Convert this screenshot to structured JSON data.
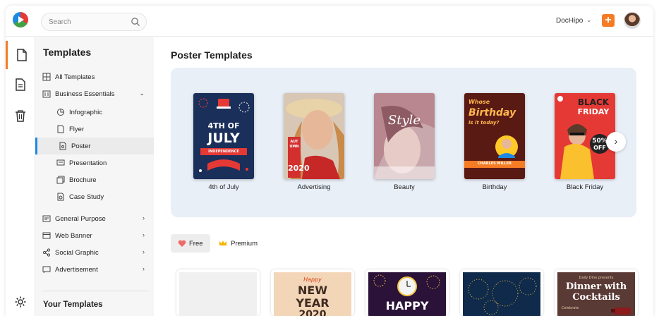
{
  "header": {
    "search_placeholder": "Search",
    "account_name": "DocHipo",
    "add_label": "+"
  },
  "sidebar": {
    "title": "Templates",
    "items": [
      {
        "label": "All Templates",
        "icon": "grid-icon"
      },
      {
        "label": "Business Essentials",
        "icon": "building-icon",
        "chevron": "⌄"
      },
      {
        "label": "Infographic",
        "icon": "chart-icon"
      },
      {
        "label": "Flyer",
        "icon": "flyer-icon"
      },
      {
        "label": "Poster",
        "icon": "poster-icon",
        "active": true
      },
      {
        "label": "Presentation",
        "icon": "presentation-icon"
      },
      {
        "label": "Brochure",
        "icon": "brochure-icon"
      },
      {
        "label": "Case Study",
        "icon": "case-study-icon"
      },
      {
        "label": "General Purpose",
        "icon": "doc-icon",
        "chevron": "›"
      },
      {
        "label": "Web Banner",
        "icon": "banner-icon",
        "chevron": "›"
      },
      {
        "label": "Social Graphic",
        "icon": "share-icon",
        "chevron": "›"
      },
      {
        "label": "Advertisement",
        "icon": "ad-icon",
        "chevron": "›"
      }
    ],
    "footer": "Your Templates"
  },
  "main": {
    "title": "Poster Templates",
    "carousel": [
      {
        "label": "4th of July",
        "text1": "4TH OF",
        "text2": "JULY",
        "banner": "INDEPENDENCE",
        "bg": "#1a2f5a"
      },
      {
        "label": "Advertising",
        "text1": "AUTUMN",
        "text2": "2020",
        "bg": "#d8c7b5"
      },
      {
        "label": "Beauty",
        "text1": "Style",
        "bg": "#c9a8ad"
      },
      {
        "label": "Birthday",
        "text1": "Whose",
        "text2": "Birthday",
        "text3": "is it today?",
        "name": "CHARLES MILLER",
        "bg": "#5a1a14"
      },
      {
        "label": "Black Friday",
        "text1": "BLACK",
        "text2": "FRIDAY",
        "deal": "50%",
        "deal_off": "OFF",
        "bg": "#e53935"
      }
    ],
    "filters": [
      {
        "label": "Free",
        "icon": "heart-icon",
        "active": true
      },
      {
        "label": "Premium",
        "icon": "crown-icon",
        "active": false
      }
    ],
    "grid": [
      {
        "text1": "",
        "bg": "#f0f0f0"
      },
      {
        "text1": "Happy",
        "text2": "NEW",
        "text3": "YEAR",
        "text4": "2020",
        "bg": "#f3d6b8"
      },
      {
        "text1": "HAPPY",
        "bg": "#2a1238"
      },
      {
        "text1": "",
        "bg": "#0f2a4a"
      },
      {
        "text0": "Daily Dine presents",
        "text1": "Dinner with",
        "text2": "Cocktails",
        "text3": "Celebrate",
        "bg": "#5a3a35"
      }
    ]
  },
  "colors": {
    "accent": "#f57c24",
    "active_indicator": "#1e88e5",
    "carousel_bg": "#e9eff7"
  }
}
